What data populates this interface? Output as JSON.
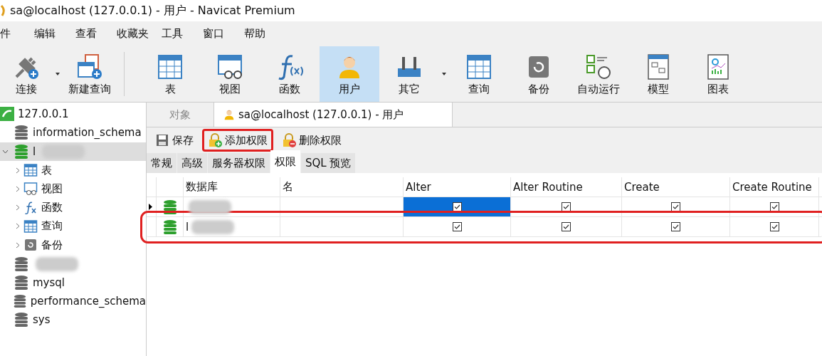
{
  "window": {
    "title": "sa@localhost (127.0.0.1) - 用户 - Navicat Premium"
  },
  "menu": [
    "件",
    "编辑",
    "查看",
    "收藏夹",
    "工具",
    "窗口",
    "帮助"
  ],
  "toolbar": [
    {
      "label": "连接",
      "dropdown": true,
      "selected": false
    },
    {
      "label": "新建查询",
      "dropdown": false,
      "selected": false
    },
    {
      "label": "表",
      "dropdown": false,
      "selected": false
    },
    {
      "label": "视图",
      "dropdown": false,
      "selected": false
    },
    {
      "label": "函数",
      "dropdown": false,
      "selected": false
    },
    {
      "label": "用户",
      "dropdown": false,
      "selected": true
    },
    {
      "label": "其它",
      "dropdown": true,
      "selected": false
    },
    {
      "label": "查询",
      "dropdown": false,
      "selected": false
    },
    {
      "label": "备份",
      "dropdown": false,
      "selected": false
    },
    {
      "label": "自动运行",
      "dropdown": false,
      "selected": false
    },
    {
      "label": "模型",
      "dropdown": false,
      "selected": false
    },
    {
      "label": "图表",
      "dropdown": false,
      "selected": false
    }
  ],
  "sidebar": {
    "items": [
      {
        "label": "127.0.0.1",
        "children": [
          {
            "label": "information_schema",
            "active": false,
            "blurred": false,
            "selected": false
          },
          {
            "label": "l",
            "active": true,
            "blurred": true,
            "selected": true,
            "expanded": true,
            "children": [
              {
                "label": "表"
              },
              {
                "label": "视图"
              },
              {
                "label": "函数"
              },
              {
                "label": "查询"
              },
              {
                "label": "备份"
              }
            ]
          },
          {
            "active": false,
            "blurred": true,
            "selected": false
          },
          {
            "label": "mysql",
            "active": false,
            "blurred": false,
            "selected": false
          },
          {
            "label": "performance_schema",
            "active": false,
            "blurred": false,
            "selected": false
          },
          {
            "label": "sys",
            "active": false,
            "blurred": false,
            "selected": false
          }
        ]
      }
    ]
  },
  "tabs": [
    {
      "label": "对象",
      "selected": false,
      "icon": false
    },
    {
      "label": "sa@localhost (127.0.0.1) - 用户",
      "selected": true,
      "icon": true
    }
  ],
  "actions": [
    {
      "label": "保存",
      "highlighted": false
    },
    {
      "label": "添加权限",
      "highlighted": true
    },
    {
      "label": "删除权限",
      "highlighted": false
    }
  ],
  "subtabs": [
    {
      "label": "常规",
      "selected": false
    },
    {
      "label": "高级",
      "selected": false
    },
    {
      "label": "服务器权限",
      "selected": false
    },
    {
      "label": "权限",
      "selected": true
    },
    {
      "label": "SQL 预览",
      "selected": false
    }
  ],
  "table": {
    "columns": [
      "数据库",
      "名",
      "Alter",
      "Alter Routine",
      "Create",
      "Create Routine"
    ],
    "rows": [
      {
        "blurred": true,
        "current": true,
        "highlighted": false,
        "perms": [
          {
            "checked": true,
            "selected": true
          },
          {
            "checked": true,
            "selected": false
          },
          {
            "checked": true,
            "selected": false
          },
          {
            "checked": true,
            "selected": false
          }
        ]
      },
      {
        "database": "l",
        "blurred": true,
        "current": false,
        "highlighted": true,
        "perms": [
          {
            "checked": true,
            "selected": false
          },
          {
            "checked": true,
            "selected": false
          },
          {
            "checked": true,
            "selected": false
          },
          {
            "checked": true,
            "selected": false
          }
        ]
      }
    ]
  }
}
